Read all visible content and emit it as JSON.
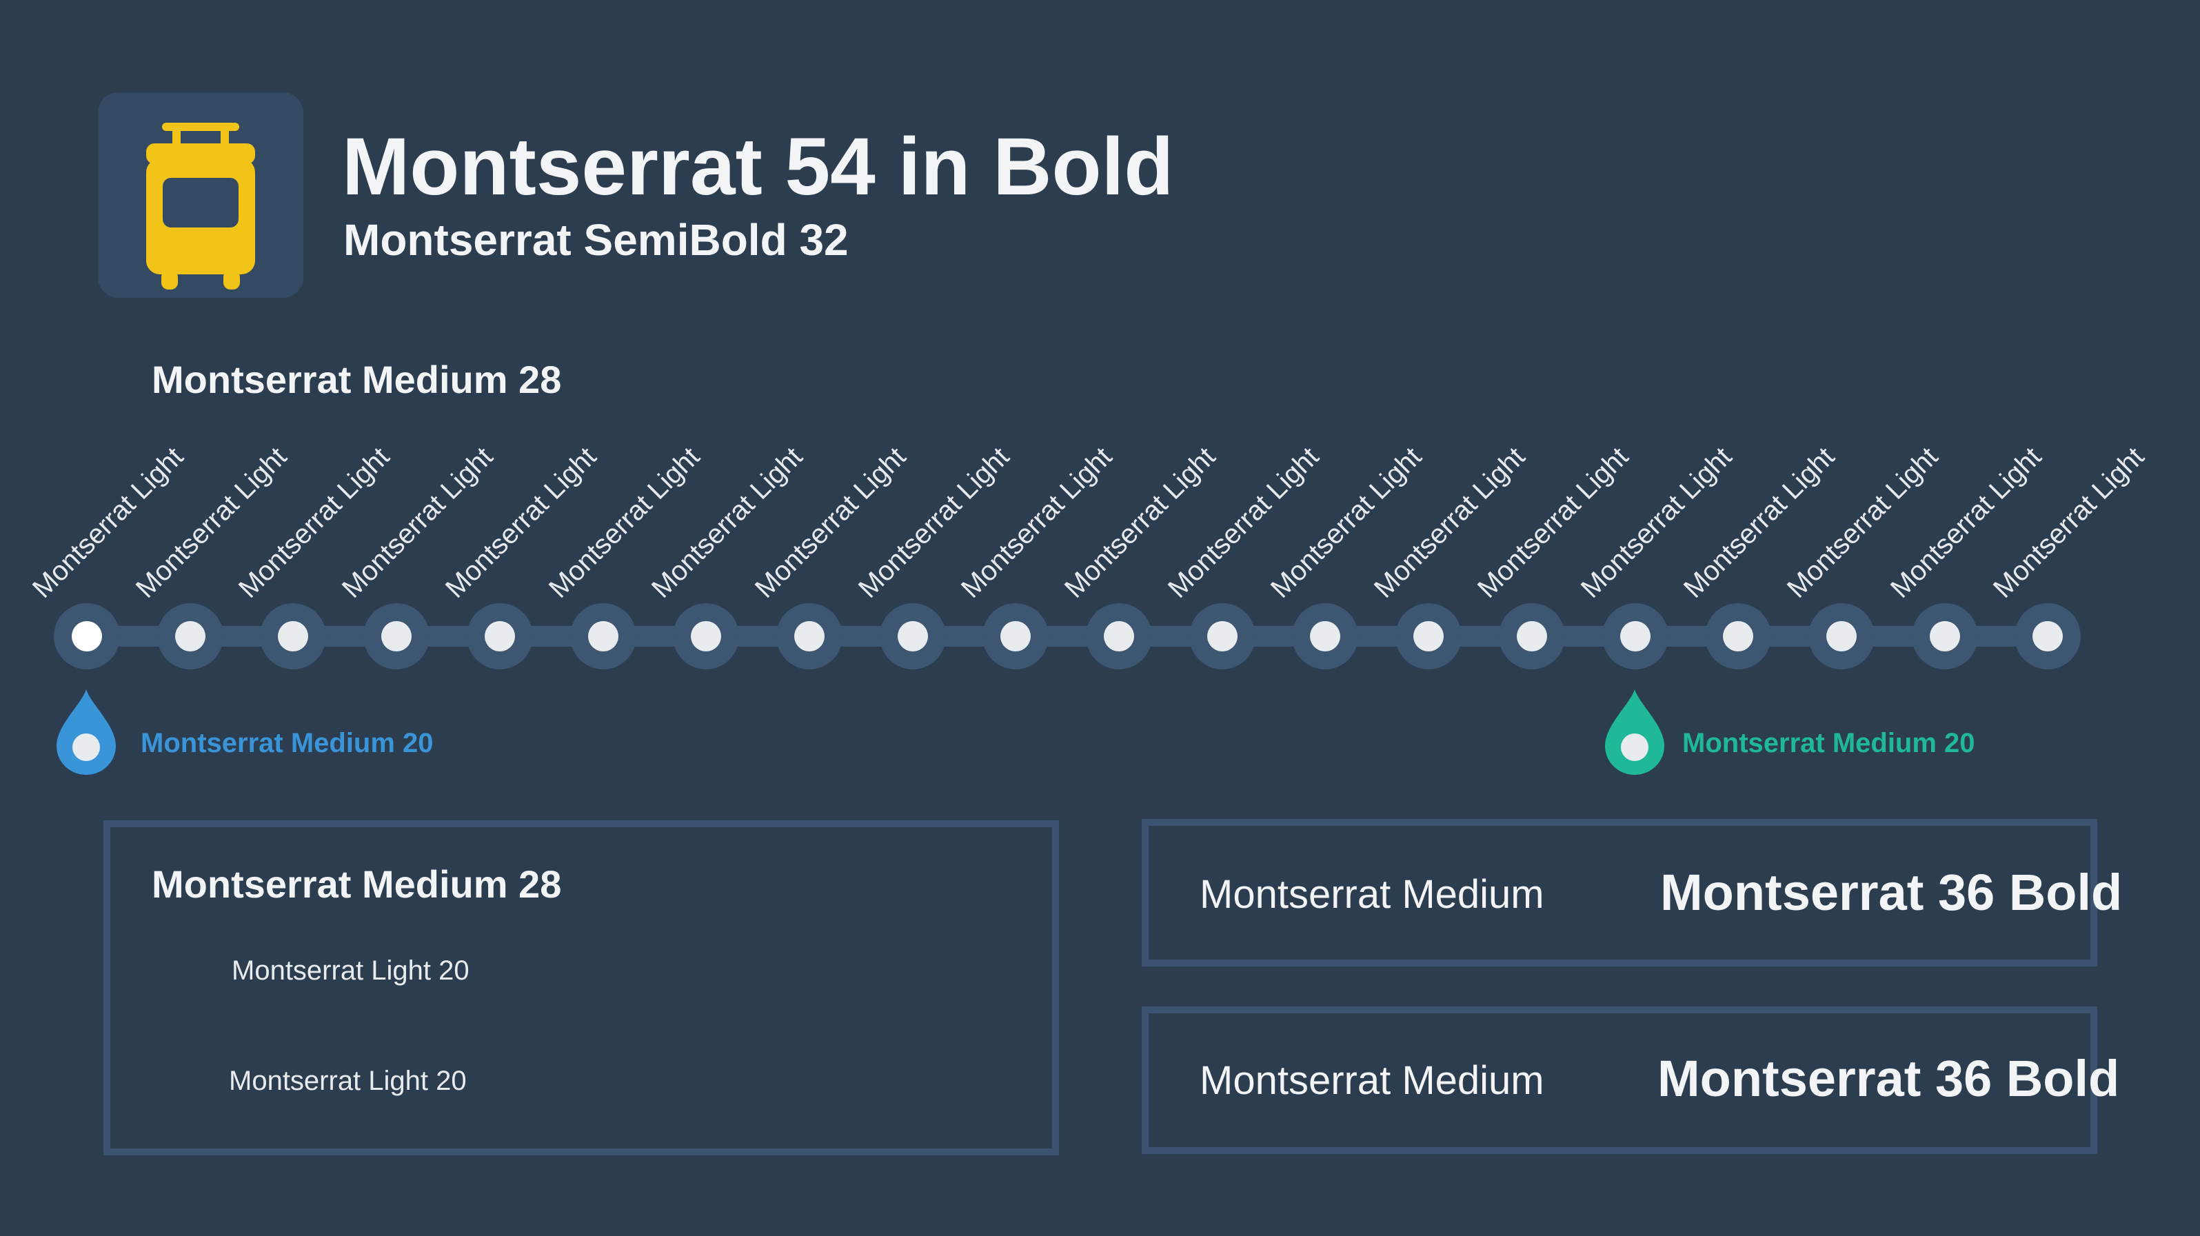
{
  "colors": {
    "background": "#2c3d50",
    "tile": "#344a63",
    "track": "#3d5672",
    "panel_border": "#3b5370",
    "accent_yellow": "#f2c418",
    "accent_blue": "#3a94d8",
    "accent_teal": "#1fb99a",
    "text": "#f2f4f6"
  },
  "header": {
    "icon": "tram-icon",
    "title": "Montserrat 54 in Bold",
    "subtitle": "Montserrat SemiBold 32"
  },
  "timeline": {
    "heading": "Montserrat Medium 28",
    "stops": [
      "Montserrat Light",
      "Montserrat Light",
      "Montserrat Light",
      "Montserrat Light",
      "Montserrat Light",
      "Montserrat Light",
      "Montserrat Light",
      "Montserrat Light",
      "Montserrat Light",
      "Montserrat Light",
      "Montserrat Light",
      "Montserrat Light",
      "Montserrat Light",
      "Montserrat Light",
      "Montserrat Light",
      "Montserrat Light",
      "Montserrat Light",
      "Montserrat Light",
      "Montserrat Light",
      "Montserrat Light"
    ],
    "markers": [
      {
        "icon": "drop-pin-icon",
        "label": "Montserrat Medium 20",
        "color": "#3a94d8"
      },
      {
        "icon": "drop-pin-icon",
        "label": "Montserrat Medium 20",
        "color": "#1fb99a"
      }
    ]
  },
  "left_panel": {
    "heading": "Montserrat Medium 28",
    "lines": [
      "Montserrat Light  20",
      "Montserrat Light 20"
    ]
  },
  "right_panels": [
    {
      "label": "Montserrat Medium",
      "value": "Montserrat 36 Bold"
    },
    {
      "label": "Montserrat Medium",
      "value": "Montserrat 36 Bold"
    }
  ]
}
